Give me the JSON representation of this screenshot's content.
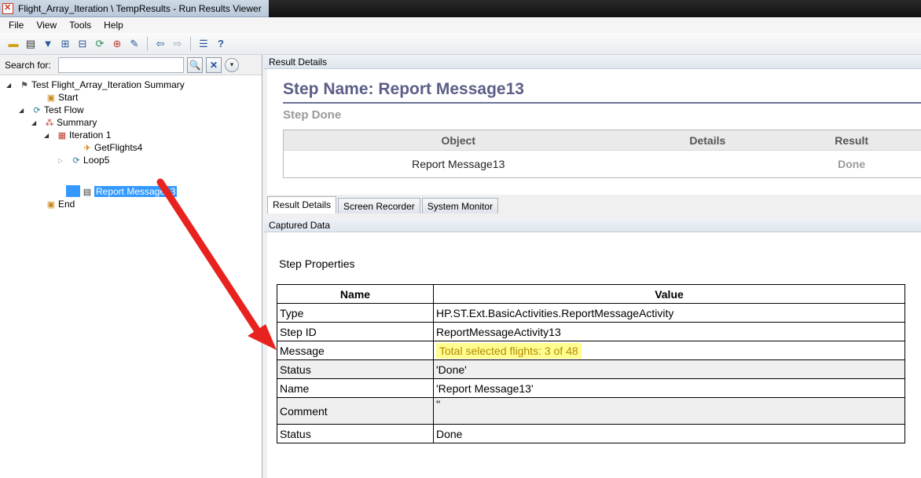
{
  "window": {
    "title": "Flight_Array_Iteration \\ TempResults - Run Results Viewer"
  },
  "menu": [
    "File",
    "View",
    "Tools",
    "Help"
  ],
  "toolbar_icons": [
    "open-icon",
    "print-icon",
    "filter-icon",
    "expand-icon",
    "collapse-icon",
    "refresh-icon",
    "add-icon",
    "edit-icon",
    "back-icon",
    "forward-icon",
    "list-icon",
    "help-icon"
  ],
  "search": {
    "label": "Search for:",
    "value": ""
  },
  "tree": {
    "root": "Test Flight_Array_Iteration Summary",
    "start": "Start",
    "test_flow": "Test Flow",
    "summary": "Summary",
    "iteration": "Iteration 1",
    "getflights": "GetFlights4",
    "loop": "Loop5",
    "report": "Report Message13",
    "end": "End"
  },
  "result_details": {
    "header": "Result Details",
    "step_name": "Step Name: Report Message13",
    "step_status": "Step Done",
    "columns": [
      "Object",
      "Details",
      "Result"
    ],
    "row": {
      "object": "Report Message13",
      "details": "",
      "result": "Done"
    }
  },
  "tabs": [
    "Result Details",
    "Screen Recorder",
    "System Monitor"
  ],
  "captured": {
    "header": "Captured Data",
    "title": "Step Properties",
    "columns": [
      "Name",
      "Value"
    ],
    "rows": [
      {
        "name": "Type",
        "value": "HP.ST.Ext.BasicActivities.ReportMessageActivity"
      },
      {
        "name": "Step ID",
        "value": "ReportMessageActivity13"
      },
      {
        "name": "Message",
        "value": "Total selected flights: 3 of 48"
      },
      {
        "name": "Status",
        "value": "'Done'"
      },
      {
        "name": "Name",
        "value": "'Report Message13'"
      },
      {
        "name": "Comment",
        "value": "''"
      },
      {
        "name": "Status",
        "value": "Done"
      }
    ]
  },
  "colors": {
    "highlight": "#fffd90",
    "selection": "#3399ff",
    "arrow": "#e8231f",
    "step_title": "#5b5e86"
  }
}
